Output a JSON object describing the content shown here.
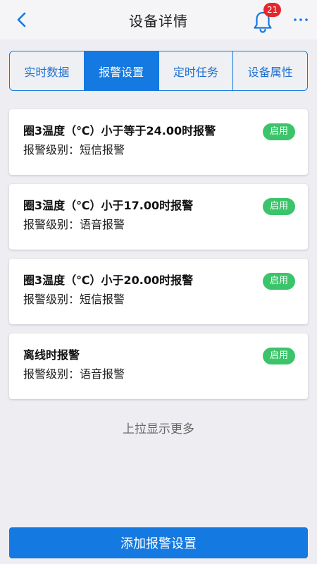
{
  "header": {
    "title": "设备详情",
    "notification_count": "21"
  },
  "tabs": [
    {
      "label": "实时数据",
      "active": false
    },
    {
      "label": "报警设置",
      "active": true
    },
    {
      "label": "定时任务",
      "active": false
    },
    {
      "label": "设备属性",
      "active": false
    }
  ],
  "alarms": [
    {
      "title": "圈3温度（℃）小于等于24.00时报警",
      "level": "报警级别：短信报警",
      "status": "启用"
    },
    {
      "title": "圈3温度（℃）小于17.00时报警",
      "level": "报警级别：语音报警",
      "status": "启用"
    },
    {
      "title": "圈3温度（℃）小于20.00时报警",
      "level": "报警级别：短信报警",
      "status": "启用"
    },
    {
      "title": "离线时报警",
      "level": "报警级别：语音报警",
      "status": "启用"
    }
  ],
  "load_more": "上拉显示更多",
  "add_button_label": "添加报警设置",
  "colors": {
    "primary": "#1479e0",
    "status_green": "#3bc46a",
    "badge_red": "#e5262b"
  }
}
